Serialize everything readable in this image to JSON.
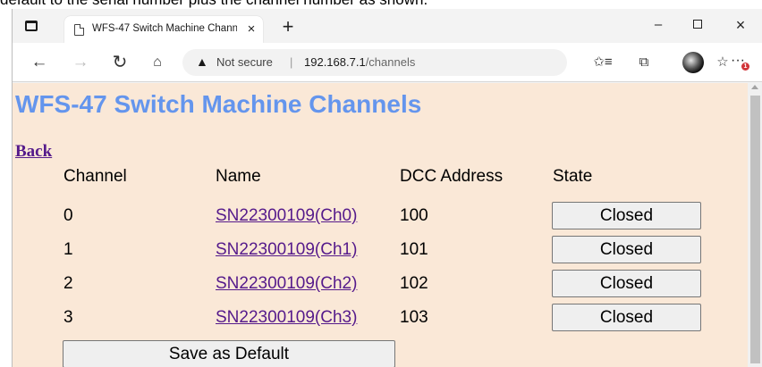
{
  "caption": "default to the serial number plus the channel number as shown.",
  "browser": {
    "tab_title": "WFS-47 Switch Machine Channels",
    "tab_close": "×",
    "new_tab": "+",
    "win_min": "–",
    "win_close": "×",
    "nav_back": "←",
    "nav_forward": "→",
    "nav_reload": "↻",
    "nav_home": "⌂",
    "security_icon": "▲",
    "security_label": "Not secure",
    "separator": "|",
    "url_host": "192.168.7.1",
    "url_path": "/channels",
    "favorite_icon": "☆",
    "favorites_icon": "✩≡",
    "collections_icon": "⧉",
    "more_icon": "···",
    "notification_count": "1"
  },
  "page": {
    "title": "WFS-47 Switch Machine Channels",
    "back_label": "Back",
    "headers": {
      "channel": "Channel",
      "name": "Name",
      "dcc": "DCC Address",
      "state": "State"
    },
    "rows": [
      {
        "channel": "0",
        "name": "SN22300109(Ch0)",
        "dcc": "100",
        "state": "Closed"
      },
      {
        "channel": "1",
        "name": "SN22300109(Ch1)",
        "dcc": "101",
        "state": "Closed"
      },
      {
        "channel": "2",
        "name": "SN22300109(Ch2)",
        "dcc": "102",
        "state": "Closed"
      },
      {
        "channel": "3",
        "name": "SN22300109(Ch3)",
        "dcc": "103",
        "state": "Closed"
      }
    ],
    "save_label": "Save as Default"
  },
  "colors": {
    "page_background": "#fae8d7",
    "title": "#6495ed",
    "link": "#551a8b"
  }
}
